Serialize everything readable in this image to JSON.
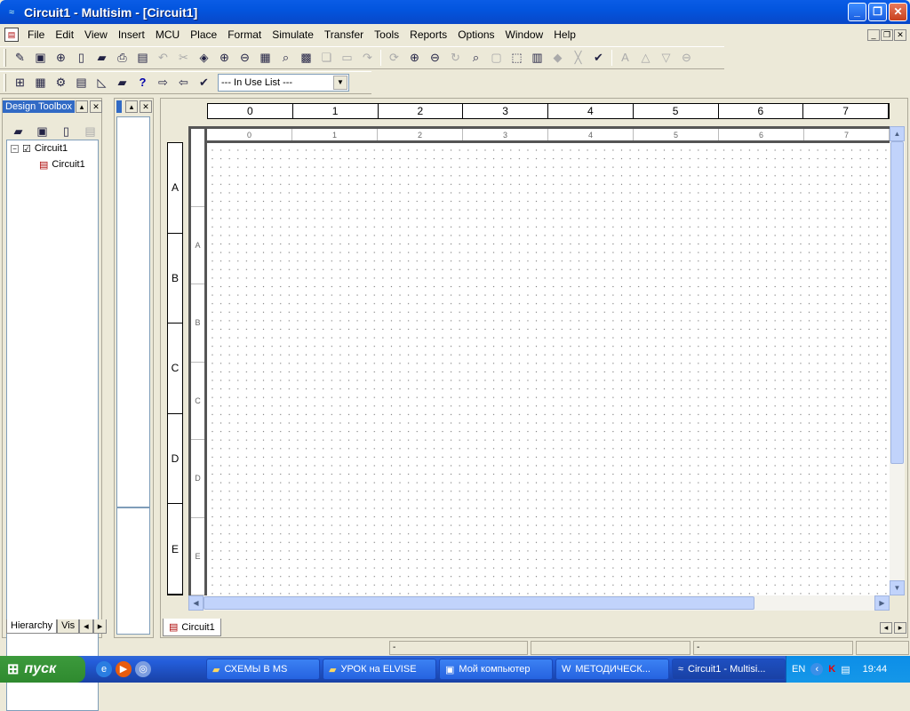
{
  "window": {
    "title": "Circuit1 - Multisim - [Circuit1]"
  },
  "menu": [
    "File",
    "Edit",
    "View",
    "Insert",
    "MCU",
    "Place",
    "Format",
    "Simulate",
    "Transfer",
    "Tools",
    "Reports",
    "Options",
    "Window",
    "Help"
  ],
  "toolbar": {
    "in_use_list": "--- In Use List ---"
  },
  "toolbox": {
    "title": "Design Toolbox",
    "tree": [
      "Circuit1",
      "Circuit1"
    ],
    "tabs": [
      "Hierarchy",
      "Vis"
    ]
  },
  "ruler": {
    "columns": [
      "0",
      "1",
      "2",
      "3",
      "4",
      "5",
      "6",
      "7"
    ],
    "rows": [
      "A",
      "B",
      "C",
      "D",
      "E"
    ]
  },
  "sheet_tab": "Circuit1",
  "status": [
    "-",
    "-"
  ],
  "taskbar": {
    "start": "пуск",
    "tasks": [
      "СХЕМЫ В MS",
      "УРОК на ELVISE",
      "Мой компьютер",
      "МЕТОДИЧЕСК...",
      "Circuit1 - Multisi..."
    ],
    "lang": "EN",
    "time": "19:44"
  }
}
